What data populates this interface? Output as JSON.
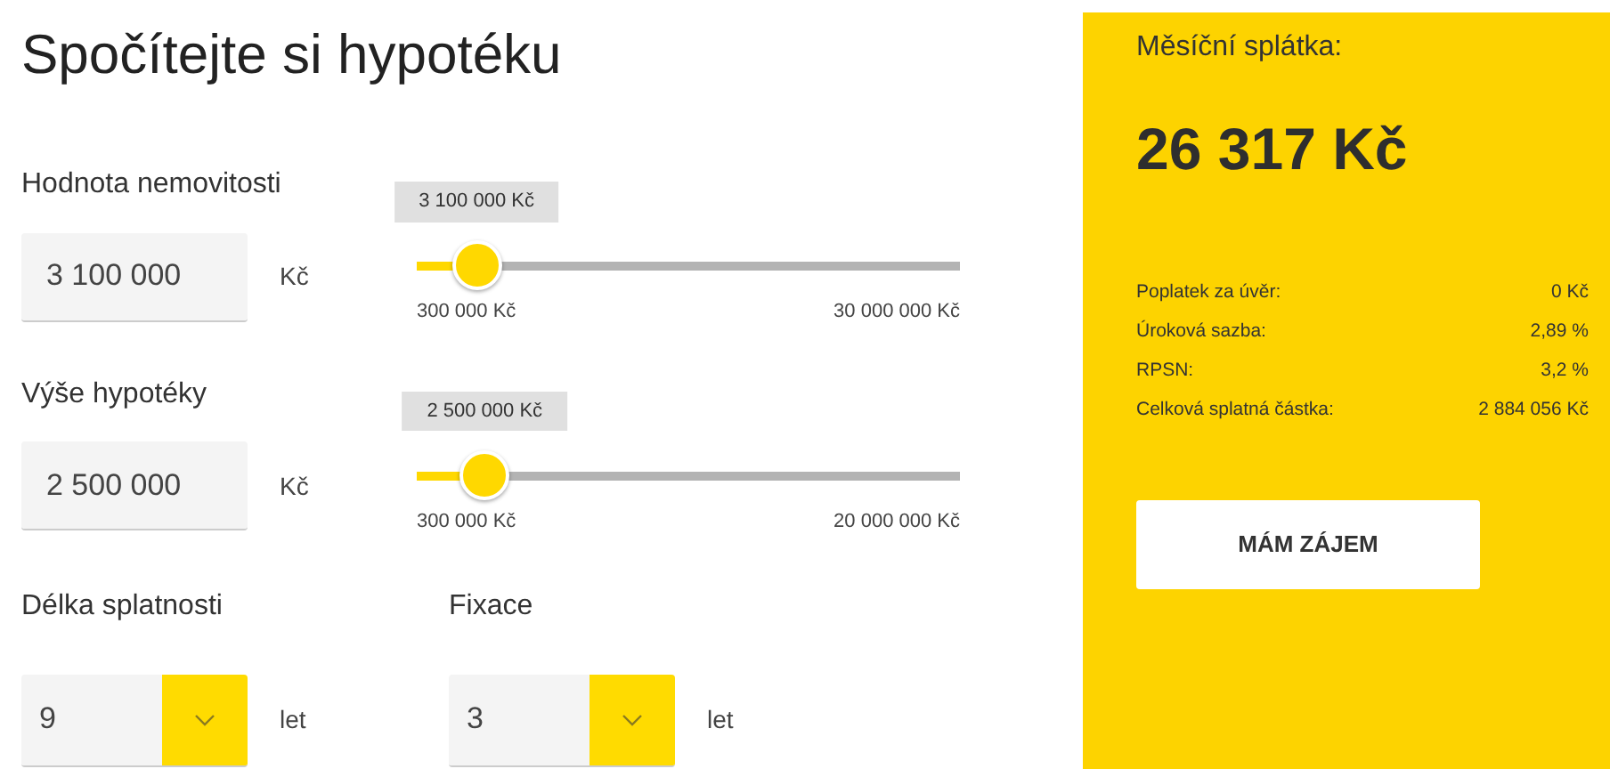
{
  "title": "Spočítejte si hypotéku",
  "amounts": [
    {
      "label": "Hodnota nemovitosti",
      "value": "3 100 000",
      "unit": "Kč",
      "slider": {
        "tooltip": "3 100 000 Kč",
        "level": 0.11,
        "min": "300 000 Kč",
        "max": "30 000 000 Kč"
      }
    },
    {
      "label": "Výše hypotéky",
      "value": "2 500 000",
      "unit": "Kč",
      "slider": {
        "tooltip": "2 500 000 Kč",
        "level": 0.125,
        "min": "300 000 Kč",
        "max": "20 000 000 Kč"
      }
    }
  ],
  "selects": [
    {
      "label": "Délka splatnosti",
      "value": "9",
      "unit": "let"
    },
    {
      "label": "Fixace",
      "value": "3",
      "unit": "let"
    }
  ],
  "summary": {
    "heading": "Měsíční splátka:",
    "payment": "26 317 Kč",
    "rows": [
      {
        "label": "Poplatek za úvěr:",
        "value": "0 Kč"
      },
      {
        "label": "Úroková sazba:",
        "value": "2,89 %"
      },
      {
        "label": "RPSN:",
        "value": "3,2 %"
      },
      {
        "label": "Celková splatná částka:",
        "value": "2 884 056 Kč"
      }
    ],
    "button": "MÁM ZÁJEM"
  }
}
